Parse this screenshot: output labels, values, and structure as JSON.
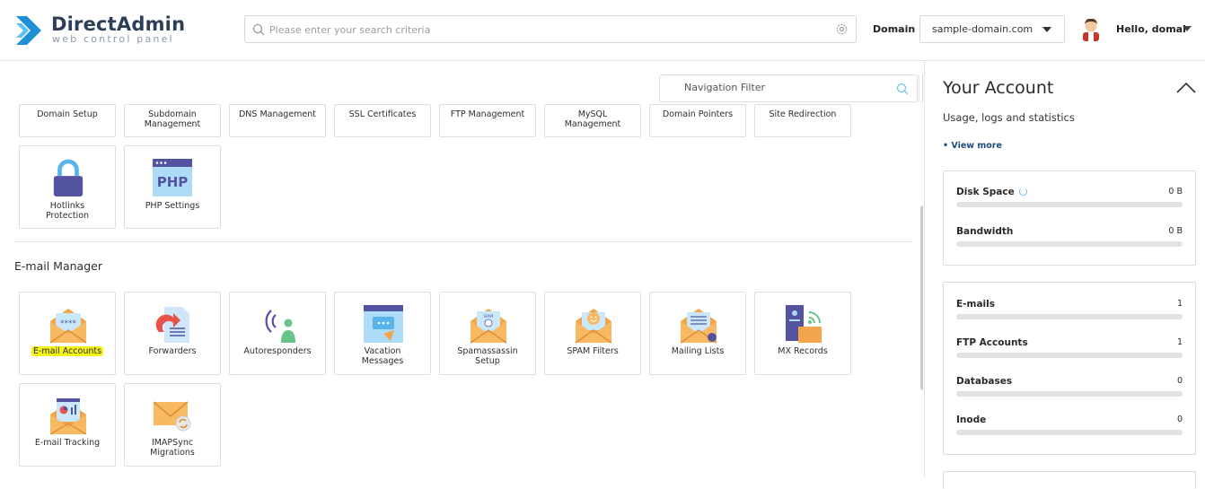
{
  "header": {
    "logo_title": "DirectAdmin",
    "logo_subtitle": "web control panel",
    "search_placeholder": "Please enter your search criteria",
    "domain_label": "Domain",
    "domain_value": "sample-domain.com",
    "greeting": "Hello, domai"
  },
  "nav_filter": {
    "placeholder": "Navigation Filter"
  },
  "top_tiles": [
    {
      "label": "Domain Setup"
    },
    {
      "label": "Subdomain Management"
    },
    {
      "label": "DNS Management"
    },
    {
      "label": "SSL Certificates"
    },
    {
      "label": "FTP Management"
    },
    {
      "label": "MySQL Management"
    },
    {
      "label": "Domain Pointers"
    },
    {
      "label": "Site Redirection"
    }
  ],
  "second_tiles": [
    {
      "label": "Hotlinks Protection",
      "icon": "lock-icon"
    },
    {
      "label": "PHP Settings",
      "icon": "php-icon",
      "icon_text": "PHP"
    }
  ],
  "email_section": {
    "title": "E-mail Manager",
    "tiles": [
      {
        "label": "E-mail Accounts",
        "icon": "email-accounts-icon",
        "highlighted": true
      },
      {
        "label": "Forwarders",
        "icon": "forwarders-icon"
      },
      {
        "label": "Autoresponders",
        "icon": "autoresponders-icon"
      },
      {
        "label": "Vacation Messages",
        "icon": "vacation-messages-icon"
      },
      {
        "label": "Spamassassin Setup",
        "icon": "spamassassin-icon"
      },
      {
        "label": "SPAM Filters",
        "icon": "spam-filters-icon"
      },
      {
        "label": "Mailing Lists",
        "icon": "mailing-lists-icon"
      },
      {
        "label": "MX Records",
        "icon": "mx-records-icon"
      },
      {
        "label": "E-mail Tracking",
        "icon": "email-tracking-icon"
      },
      {
        "label": "IMAPSync Migrations",
        "icon": "imapsync-icon"
      }
    ]
  },
  "account": {
    "title": "Your Account",
    "subtitle": "Usage, logs and statistics",
    "view_more": "• View more",
    "usage": [
      {
        "name": "Disk Space",
        "value": "0 B"
      },
      {
        "name": "Bandwidth",
        "value": "0 B"
      }
    ],
    "counts": [
      {
        "name": "E-mails",
        "value": "1"
      },
      {
        "name": "FTP Accounts",
        "value": "1"
      },
      {
        "name": "Databases",
        "value": "0"
      },
      {
        "name": "Inode",
        "value": "0"
      }
    ]
  },
  "colors": {
    "brand": "#2c3e58",
    "logo_blue": "#1e90d6",
    "highlight": "#f5f218",
    "envelope": "#f2a54a"
  }
}
